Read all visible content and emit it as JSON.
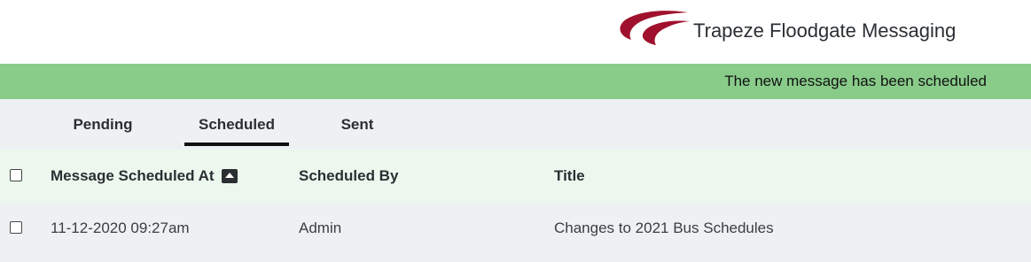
{
  "header": {
    "app_title": "Trapeze Floodgate Messaging",
    "logo_icon": "trapeze-logo-icon",
    "brand_color": "#a0112d"
  },
  "notification": {
    "text": "The new message has been scheduled",
    "color": "#89cc8a"
  },
  "tabs": [
    {
      "label": "Pending",
      "active": false
    },
    {
      "label": "Scheduled",
      "active": true
    },
    {
      "label": "Sent",
      "active": false
    }
  ],
  "table": {
    "columns": [
      {
        "label": "Message Scheduled At",
        "sort_icon": "sort-ascending-icon"
      },
      {
        "label": "Scheduled By"
      },
      {
        "label": "Title"
      }
    ],
    "rows": [
      {
        "scheduled_at": "11-12-2020 09:27am",
        "scheduled_by": "Admin",
        "title": "Changes to 2021 Bus Schedules",
        "checked": false
      }
    ]
  }
}
